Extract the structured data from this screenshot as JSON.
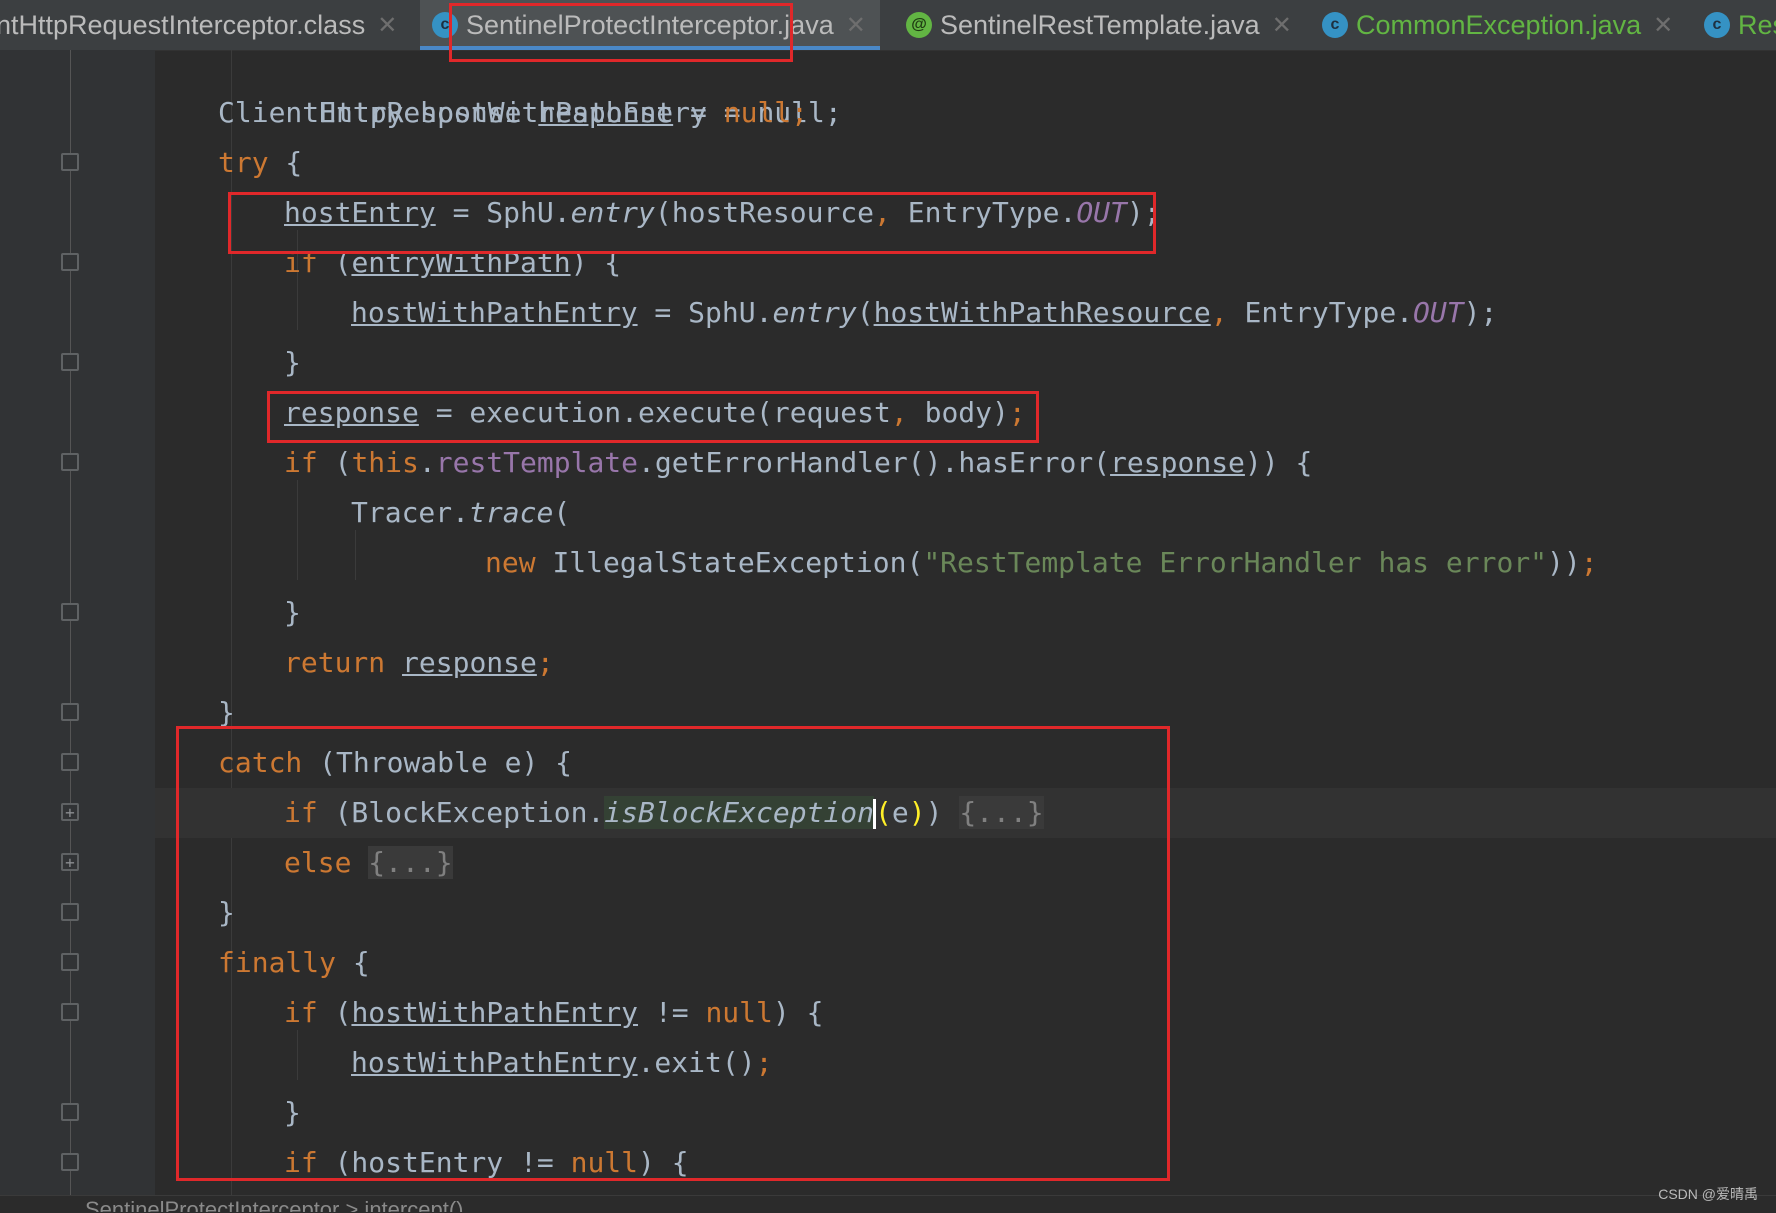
{
  "tabs": [
    {
      "label": "ntHttpRequestInterceptor.class",
      "icon": "class-file-icon",
      "active": false
    },
    {
      "label": "SentinelProtectInterceptor.java",
      "icon": "class-icon",
      "active": true
    },
    {
      "label": "SentinelRestTemplate.java",
      "icon": "annotation-icon",
      "active": false
    },
    {
      "label": "CommonException.java",
      "icon": "class-icon",
      "active": false
    },
    {
      "label": "Res",
      "icon": "class-icon",
      "active": false
    }
  ],
  "code": {
    "l0": "Entry hostWithPathEntry = null;",
    "l1_a": "ClientHttpResponse ",
    "l1_b": "response",
    "l1_c": " = ",
    "l1_d": "null",
    "l1_e": ";",
    "l2_a": "try",
    "l2_b": " {",
    "l3_a": "hostEntry",
    "l3_b": " = SphU.",
    "l3_c": "entry",
    "l3_d": "(hostResource",
    "l3_e": ", ",
    "l3_f": "EntryType.",
    "l3_g": "OUT",
    "l3_h": ");",
    "l4_a": "if",
    "l4_b": " (",
    "l4_c": "entryWithPath",
    "l4_d": ") {",
    "l5_a": "hostWithPathEntry",
    "l5_b": " = SphU.",
    "l5_c": "entry",
    "l5_d": "(",
    "l5_e": "hostWithPathResource",
    "l5_f": ", ",
    "l5_g": "EntryType.",
    "l5_h": "OUT",
    "l5_i": ");",
    "l6": "}",
    "l7_a": "response",
    "l7_b": " = execution.execute(request",
    "l7_c": ", ",
    "l7_d": "body)",
    "l7_e": ";",
    "l8_a": "if",
    "l8_b": " (",
    "l8_c": "this",
    "l8_d": ".",
    "l8_e": "restTemplate",
    "l8_f": ".getErrorHandler().hasError(",
    "l8_g": "response",
    "l8_h": ")) {",
    "l9_a": "Tracer.",
    "l9_b": "trace",
    "l9_c": "(",
    "l10_a": "new ",
    "l10_b": "IllegalStateException(",
    "l10_c": "\"RestTemplate ErrorHandler has error\"",
    "l10_d": "))",
    "l10_e": ";",
    "l11": "}",
    "l12_a": "return ",
    "l12_b": "response",
    "l12_c": ";",
    "l13": "}",
    "l14_a": "catch",
    "l14_b": " (Throwable e) {",
    "l15_a": "if",
    "l15_b": " (BlockException.",
    "l15_c": "isBlockException",
    "l15_d": "(",
    "l15_e": "e",
    "l15_f": ")",
    "l15_g": ") ",
    "l15_h": "{...}",
    "l16_a": "else",
    "l16_b": " ",
    "l16_c": "{...}",
    "l17": "}",
    "l18_a": "finally",
    "l18_b": " {",
    "l19_a": "if",
    "l19_b": " (",
    "l19_c": "hostWithPathEntry",
    "l19_d": " != ",
    "l19_e": "null",
    "l19_f": ") {",
    "l20_a": "hostWithPathEntry",
    "l20_b": ".exit()",
    "l20_c": ";",
    "l21": "}",
    "l22_a": "if",
    "l22_b": " (hostEntry != ",
    "l22_c": "null",
    "l22_d": ") {"
  },
  "breadcrumb": "SentinelProtectInterceptor > intercept()",
  "watermark": "CSDN @爱晴禹",
  "colors": {
    "keyword": "#cc7832",
    "field": "#9876aa",
    "string": "#6a8759",
    "text": "#a9b7c6",
    "annotation_box": "#e0282a",
    "background": "#2b2b2b"
  }
}
